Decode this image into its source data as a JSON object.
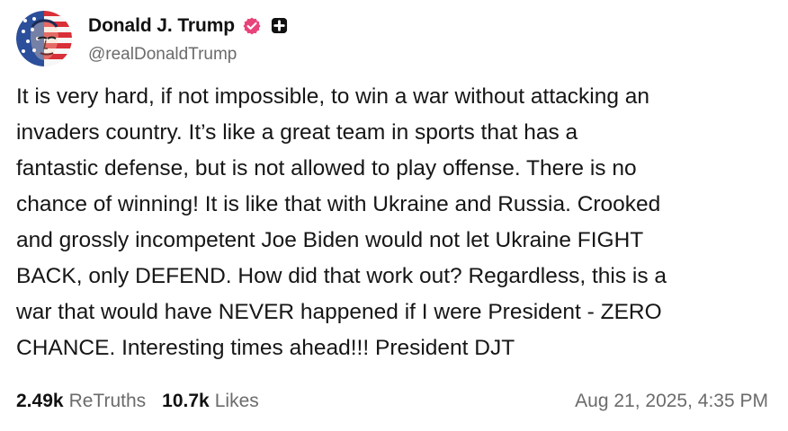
{
  "post": {
    "author": {
      "display_name": "Donald J. Trump",
      "handle": "@realDonaldTrump",
      "avatar_icon": "american-flag-portrait-avatar",
      "verified_icon": "verified-badge-icon",
      "plus_icon": "plus-badge-icon",
      "verified_color": "#e8447a"
    },
    "text": "It is very hard, if not impossible, to win a war without attacking an\ninvaders country. It’s like a great team in sports that has a\nfantastic defense, but is not allowed to play offense. There is no\nchance of winning! It is like that with Ukraine and Russia. Crooked\nand grossly incompetent Joe Biden would not let Ukraine FIGHT\nBACK, only DEFEND. How did that work out? Regardless, this is a\nwar that would have NEVER happened if I were President - ZERO\nCHANCE. Interesting times ahead!!! President DJT",
    "stats": {
      "retruths_count": "2.49k",
      "retruths_label": "ReTruths",
      "likes_count": "10.7k",
      "likes_label": "Likes"
    },
    "timestamp": "Aug 21, 2025, 4:35 PM"
  }
}
